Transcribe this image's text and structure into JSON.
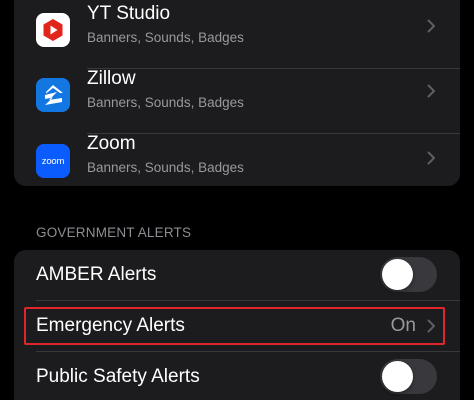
{
  "apps": [
    {
      "name": "YT Studio",
      "subtitle": "Banners, Sounds, Badges",
      "icon": "yt-studio-icon",
      "icon_bg": "#ffffff",
      "icon_fg": "#e1251b"
    },
    {
      "name": "Zillow",
      "subtitle": "Banners, Sounds, Badges",
      "icon": "zillow-icon",
      "icon_bg": "#1277e1",
      "icon_fg": "#ffffff"
    },
    {
      "name": "Zoom",
      "subtitle": "Banners, Sounds, Badges",
      "icon": "zoom-icon",
      "icon_bg": "#0b5cff",
      "icon_fg": "#ffffff",
      "icon_text": "zoom"
    }
  ],
  "government_alerts": {
    "header": "GOVERNMENT ALERTS",
    "amber": {
      "label": "AMBER Alerts",
      "enabled": false
    },
    "emergency": {
      "label": "Emergency Alerts",
      "value": "On"
    },
    "public_safety": {
      "label": "Public Safety Alerts",
      "enabled": false
    }
  },
  "colors": {
    "background": "#000000",
    "group_bg": "#1c1c1e",
    "secondary_text": "#98989e",
    "highlight": "#e0262b",
    "toggle_off": "#39393d"
  }
}
